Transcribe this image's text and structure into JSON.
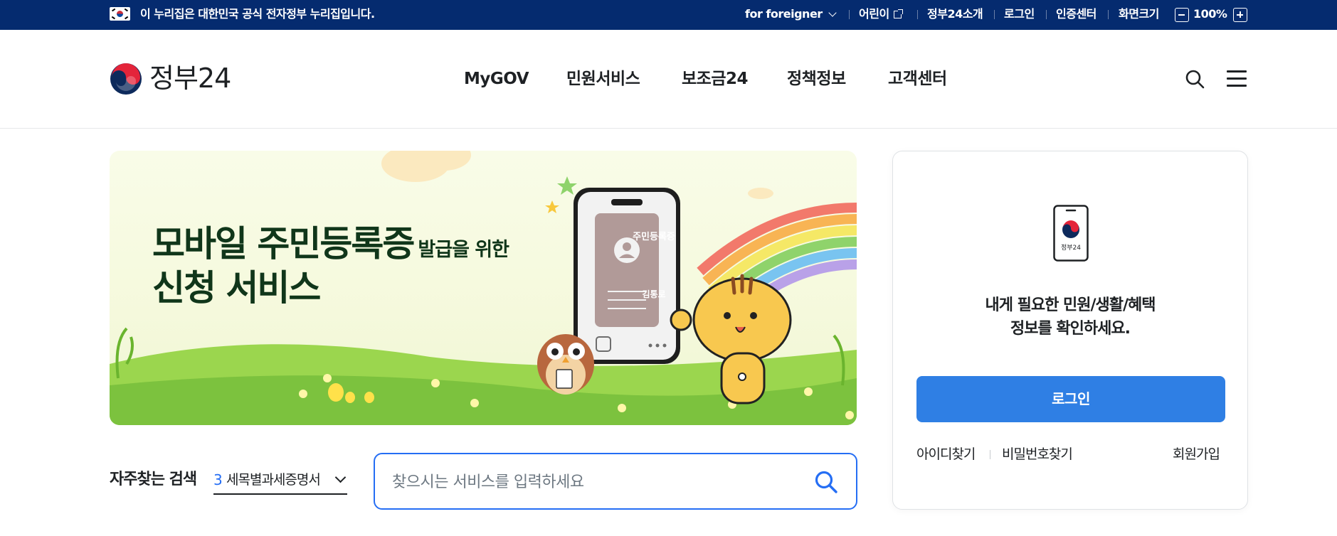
{
  "gov_bar": {
    "notice": "이 누리집은 대한민국 공식 전자정부 누리집입니다.",
    "foreigner": "for foreigner",
    "kids": "어린이",
    "about": "정부24소개",
    "login": "로그인",
    "cert": "인증센터",
    "screen_size_label": "화면크기",
    "zoom": "100%"
  },
  "header": {
    "logo_text": "정부24",
    "nav": [
      "MyGOV",
      "민원서비스",
      "보조금24",
      "정책정보",
      "고객센터"
    ]
  },
  "banner": {
    "title_main": "모바일 주민등록증",
    "title_small": "발급을 위한",
    "title_line2": "신청 서비스",
    "id_card_title": "주민등록증",
    "id_card_name": "김통로"
  },
  "search": {
    "fav_label": "자주찾는 검색",
    "fav_rank": "3",
    "fav_keyword": "세목별과세증명서",
    "placeholder": "찾으시는 서비스를 입력하세요"
  },
  "login_card": {
    "icon_label": "정부24",
    "message_line1": "내게 필요한 민원/생활/혜택",
    "message_line2": "정보를 확인하세요.",
    "login_button": "로그인",
    "find_id": "아이디찾기",
    "find_password": "비밀번호찾기",
    "signup": "회원가입"
  },
  "colors": {
    "gov_bar": "#052b6f",
    "accent_blue": "#256ef4",
    "login_button": "#2f7fe4"
  }
}
